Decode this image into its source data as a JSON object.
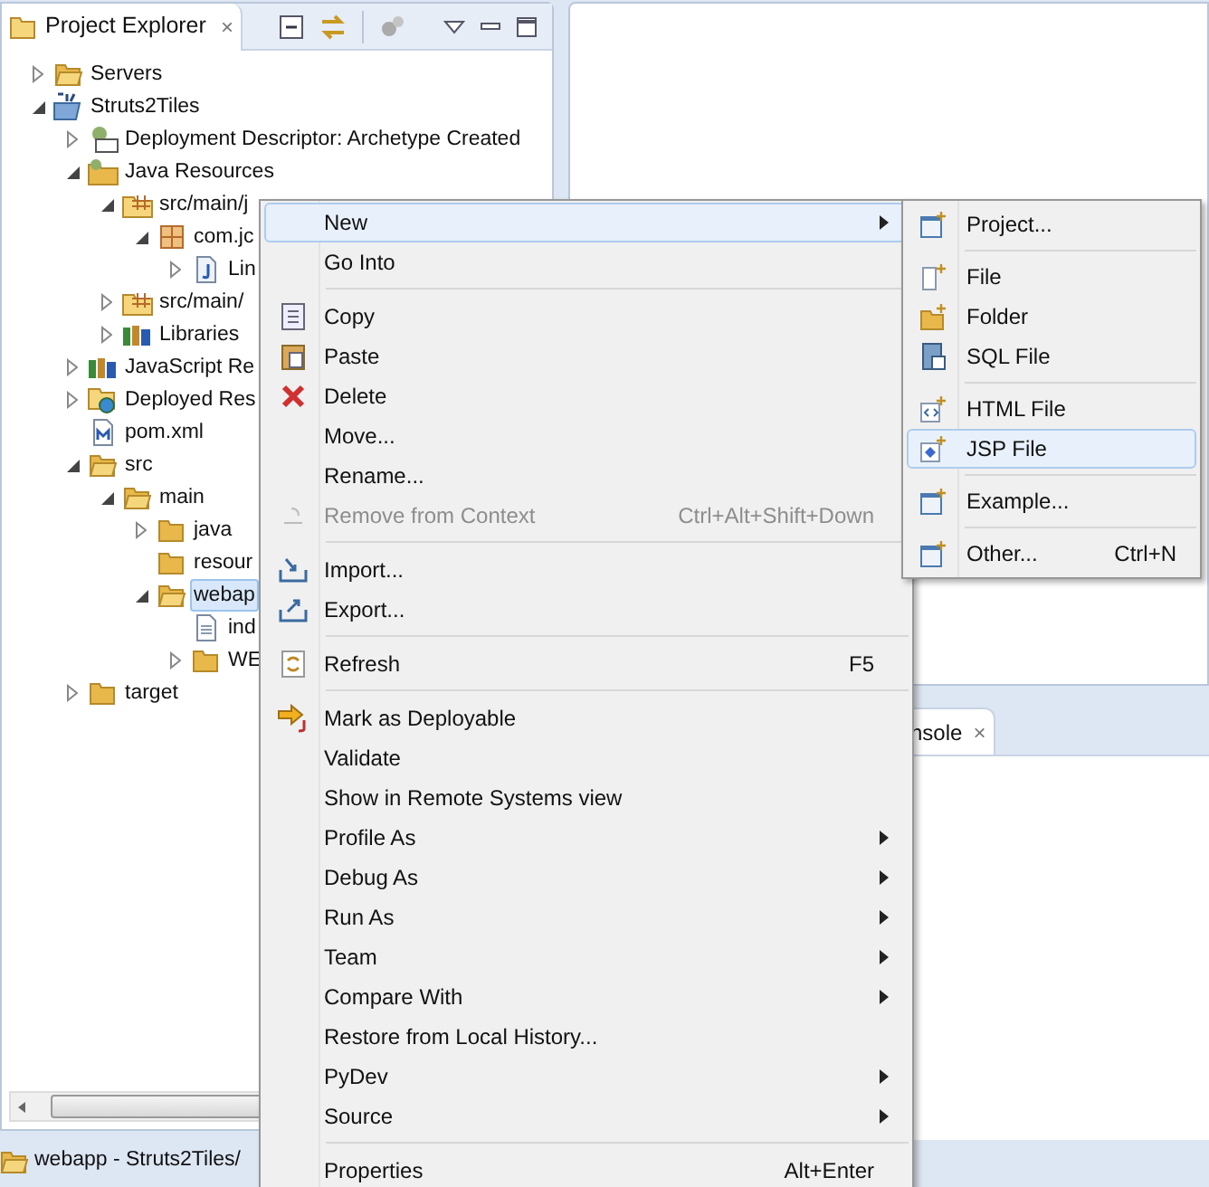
{
  "explorer": {
    "tab": {
      "label": "Project Explorer",
      "close": "×"
    },
    "tree": [
      {
        "label": "Servers",
        "kind": "servers",
        "expandable": true,
        "expanded": false,
        "selected": false
      },
      {
        "label": "Struts2Tiles",
        "kind": "project",
        "expandable": true,
        "expanded": true,
        "selected": false,
        "children": [
          {
            "label": "Deployment Descriptor: Archetype Created",
            "kind": "descriptor",
            "expandable": true,
            "expanded": false,
            "selected": false
          },
          {
            "label": "Java Resources",
            "kind": "resources",
            "expandable": true,
            "expanded": true,
            "selected": false,
            "children": [
              {
                "label": "src/main/j",
                "kind": "source",
                "expandable": true,
                "expanded": true,
                "selected": false,
                "children": [
                  {
                    "label": "com.jc",
                    "kind": "package",
                    "expandable": true,
                    "expanded": true,
                    "selected": false,
                    "children": [
                      {
                        "label": "Lin",
                        "kind": "java",
                        "expandable": true,
                        "expanded": false,
                        "selected": false
                      }
                    ]
                  }
                ]
              },
              {
                "label": "src/main/",
                "kind": "source",
                "expandable": true,
                "expanded": false,
                "selected": false
              },
              {
                "label": "Libraries",
                "kind": "library",
                "expandable": true,
                "expanded": false,
                "selected": false
              }
            ]
          },
          {
            "label": "JavaScript Re",
            "kind": "library",
            "expandable": true,
            "expanded": false,
            "selected": false
          },
          {
            "label": "Deployed Res",
            "kind": "deployed",
            "expandable": true,
            "expanded": false,
            "selected": false
          },
          {
            "label": "pom.xml",
            "kind": "xml",
            "expandable": false,
            "expanded": false,
            "selected": false
          },
          {
            "label": "src",
            "kind": "folder",
            "expandable": true,
            "expanded": true,
            "selected": false,
            "children": [
              {
                "label": "main",
                "kind": "folder",
                "expandable": true,
                "expanded": true,
                "selected": false,
                "children": [
                  {
                    "label": "java",
                    "kind": "folder",
                    "expandable": true,
                    "expanded": false,
                    "selected": false
                  },
                  {
                    "label": "resour",
                    "kind": "folder",
                    "expandable": false,
                    "expanded": false,
                    "selected": false
                  },
                  {
                    "label": "webap",
                    "kind": "folder",
                    "expandable": true,
                    "expanded": true,
                    "selected": true,
                    "children": [
                      {
                        "label": "ind",
                        "kind": "file",
                        "expandable": false,
                        "expanded": false,
                        "selected": false
                      },
                      {
                        "label": "WE",
                        "kind": "folder",
                        "expandable": true,
                        "expanded": false,
                        "selected": false
                      }
                    ]
                  }
                ]
              }
            ]
          },
          {
            "label": "target",
            "kind": "folder",
            "expandable": true,
            "expanded": false,
            "selected": false
          }
        ]
      }
    ]
  },
  "console_tab": {
    "label": "nsole",
    "close": "×"
  },
  "status_bar": {
    "text": "webapp - Struts2Tiles/"
  },
  "context_menu": {
    "groups": [
      [
        {
          "label": "New",
          "kind": "none",
          "submenu": true,
          "selected": true,
          "disabled": false
        },
        {
          "label": "Go Into",
          "kind": "none",
          "submenu": false,
          "selected": false,
          "disabled": false
        }
      ],
      [
        {
          "label": "Copy",
          "kind": "copy",
          "submenu": false,
          "selected": false,
          "disabled": false
        },
        {
          "label": "Paste",
          "kind": "paste",
          "submenu": false,
          "selected": false,
          "disabled": false
        },
        {
          "label": "Delete",
          "kind": "delete",
          "submenu": false,
          "selected": false,
          "disabled": false
        },
        {
          "label": "Move...",
          "kind": "none",
          "submenu": false,
          "selected": false,
          "disabled": false
        },
        {
          "label": "Rename...",
          "kind": "none",
          "submenu": false,
          "selected": false,
          "disabled": false
        },
        {
          "label": "Remove from Context",
          "kind": "remove",
          "shortcut": "Ctrl+Alt+Shift+Down",
          "submenu": false,
          "selected": false,
          "disabled": true
        }
      ],
      [
        {
          "label": "Import...",
          "kind": "import",
          "submenu": false,
          "selected": false,
          "disabled": false
        },
        {
          "label": "Export...",
          "kind": "export",
          "submenu": false,
          "selected": false,
          "disabled": false
        }
      ],
      [
        {
          "label": "Refresh",
          "kind": "refresh",
          "shortcut": "F5",
          "submenu": false,
          "selected": false,
          "disabled": false
        }
      ],
      [
        {
          "label": "Mark as Deployable",
          "kind": "deploy",
          "submenu": false,
          "selected": false,
          "disabled": false
        },
        {
          "label": "Validate",
          "kind": "none",
          "submenu": false,
          "selected": false,
          "disabled": false
        },
        {
          "label": "Show in Remote Systems view",
          "kind": "none",
          "submenu": false,
          "selected": false,
          "disabled": false
        },
        {
          "label": "Profile As",
          "kind": "none",
          "submenu": true,
          "selected": false,
          "disabled": false
        },
        {
          "label": "Debug As",
          "kind": "none",
          "submenu": true,
          "selected": false,
          "disabled": false
        },
        {
          "label": "Run As",
          "kind": "none",
          "submenu": true,
          "selected": false,
          "disabled": false
        },
        {
          "label": "Team",
          "kind": "none",
          "submenu": true,
          "selected": false,
          "disabled": false
        },
        {
          "label": "Compare With",
          "kind": "none",
          "submenu": true,
          "selected": false,
          "disabled": false
        },
        {
          "label": "Restore from Local History...",
          "kind": "none",
          "submenu": false,
          "selected": false,
          "disabled": false
        },
        {
          "label": "PyDev",
          "kind": "none",
          "submenu": true,
          "selected": false,
          "disabled": false
        },
        {
          "label": "Source",
          "kind": "none",
          "submenu": true,
          "selected": false,
          "disabled": false
        }
      ],
      [
        {
          "label": "Properties",
          "kind": "none",
          "shortcut": "Alt+Enter",
          "submenu": false,
          "selected": false,
          "disabled": false
        }
      ]
    ]
  },
  "submenu": {
    "groups": [
      [
        {
          "label": "Project...",
          "kind": "wizard",
          "selected": false
        }
      ],
      [
        {
          "label": "File",
          "kind": "file",
          "selected": false
        },
        {
          "label": "Folder",
          "kind": "folder",
          "selected": false
        },
        {
          "label": "SQL File",
          "kind": "sql",
          "selected": false
        }
      ],
      [
        {
          "label": "HTML File",
          "kind": "html",
          "selected": false
        },
        {
          "label": "JSP File",
          "kind": "jsp",
          "selected": true
        }
      ],
      [
        {
          "label": "Example...",
          "kind": "wizard",
          "selected": false
        }
      ],
      [
        {
          "label": "Other...",
          "kind": "wizard",
          "shortcut": "Ctrl+N",
          "selected": false
        }
      ]
    ]
  }
}
